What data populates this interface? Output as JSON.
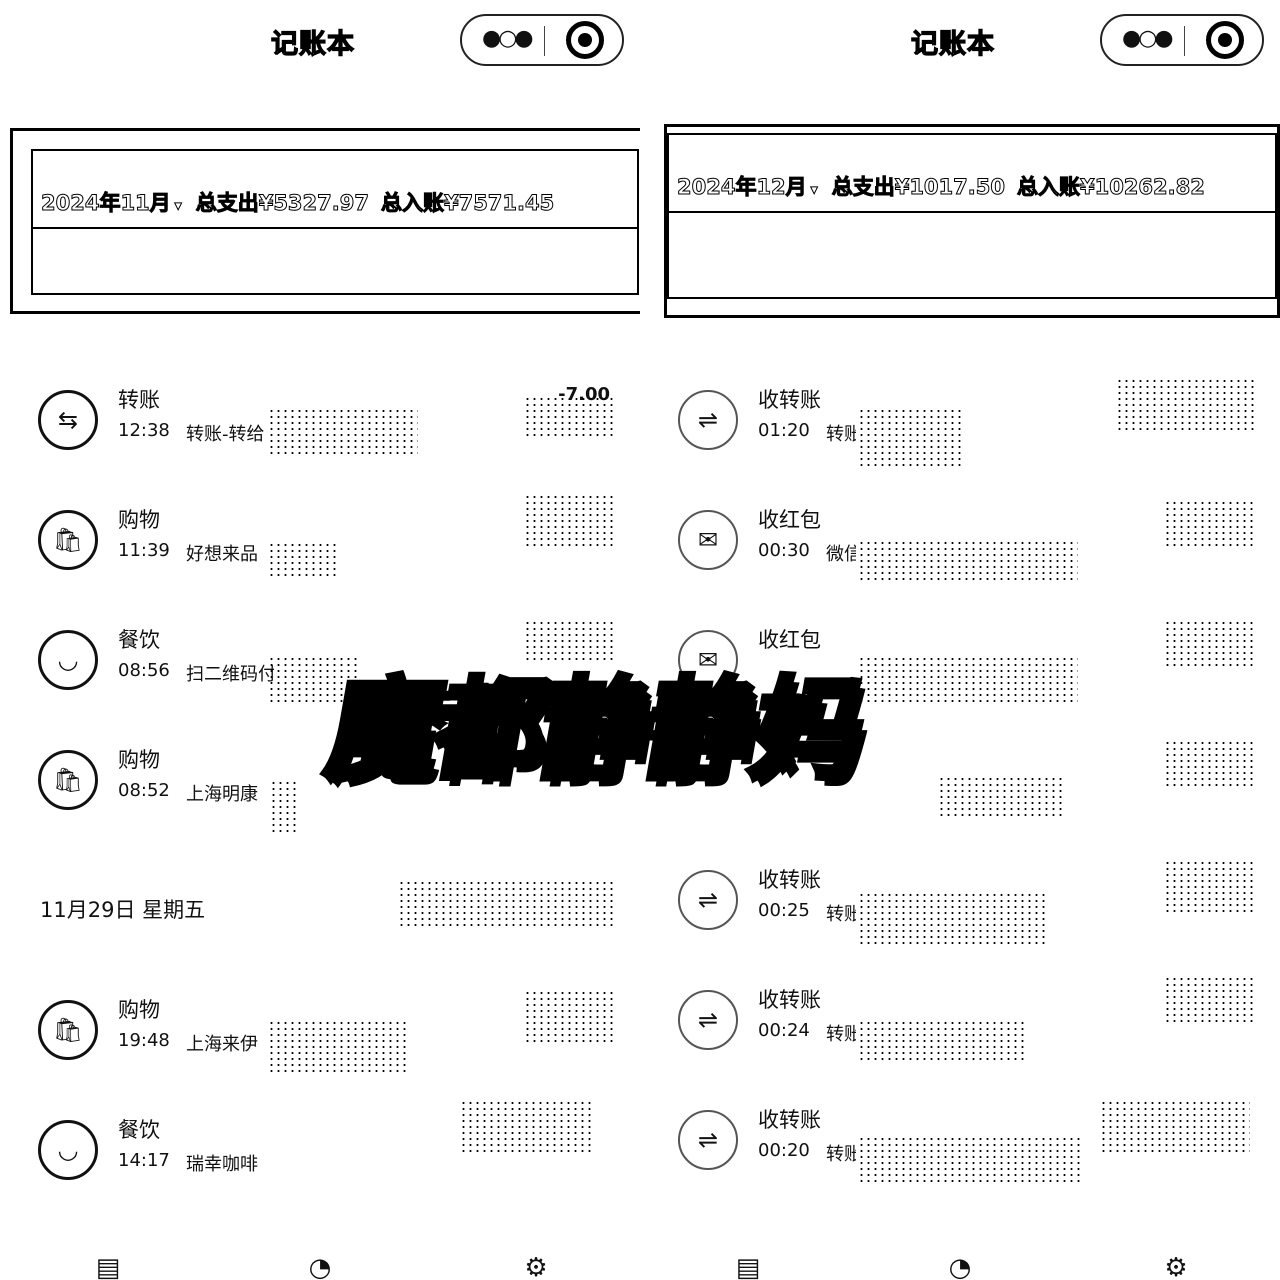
{
  "left": {
    "app_title": "记账本",
    "summary": {
      "month": "2024年11月",
      "dropdown": "▾",
      "expense": "总支出¥5327.97",
      "income": "总入账¥7571.45"
    },
    "transactions": [
      {
        "icon": "transfer-icon",
        "glyph": "⇆",
        "category": "转账",
        "time": "12:38",
        "desc": "转账-转给",
        "amount": "-7.00"
      },
      {
        "icon": "shopping-bag-icon",
        "glyph": "🛍",
        "category": "购物",
        "time": "11:39",
        "desc": "好想来品",
        "amount": ""
      },
      {
        "icon": "bowl-icon",
        "glyph": "◡",
        "category": "餐饮",
        "time": "08:56",
        "desc": "扫二维码付",
        "amount": ""
      },
      {
        "icon": "shopping-bag-icon",
        "glyph": "🛍",
        "category": "购物",
        "time": "08:52",
        "desc": "上海明康",
        "amount": ""
      }
    ],
    "date_header": "11月29日 星期五",
    "transactions2": [
      {
        "icon": "shopping-bag-icon",
        "glyph": "🛍",
        "category": "购物",
        "time": "19:48",
        "desc": "上海来伊",
        "amount": ""
      },
      {
        "icon": "bowl-icon",
        "glyph": "◡",
        "category": "餐饮",
        "time": "14:17",
        "desc": "瑞幸咖啡",
        "amount": ""
      }
    ]
  },
  "right": {
    "app_title": "记账本",
    "summary": {
      "month": "2024年12月",
      "dropdown": "▾",
      "expense": "总支出¥1017.50",
      "income": "总入账¥10262.82"
    },
    "transactions": [
      {
        "icon": "transfer-in-icon",
        "glyph": "⇌",
        "category": "收转账",
        "time": "01:20",
        "desc": "转账"
      },
      {
        "icon": "red-packet-icon",
        "glyph": "✉",
        "category": "收红包",
        "time": "00:30",
        "desc": "微信"
      },
      {
        "icon": "red-packet-icon",
        "glyph": "✉",
        "category": "收红包",
        "time": "",
        "desc": ""
      },
      {
        "icon": "transfer-in-icon",
        "glyph": "⇌",
        "category": "收转账",
        "time": "00:25",
        "desc": "转账"
      },
      {
        "icon": "transfer-in-icon",
        "glyph": "⇌",
        "category": "收转账",
        "time": "00:24",
        "desc": "转账"
      },
      {
        "icon": "transfer-in-icon",
        "glyph": "⇌",
        "category": "收转账",
        "time": "00:20",
        "desc": "转账"
      }
    ]
  },
  "tabs": [
    {
      "icon": "ledger-icon",
      "glyph": "▤"
    },
    {
      "icon": "chart-icon",
      "glyph": "◔"
    },
    {
      "icon": "settings-icon",
      "glyph": "⚙"
    }
  ],
  "watermark": "魔都静静妈"
}
